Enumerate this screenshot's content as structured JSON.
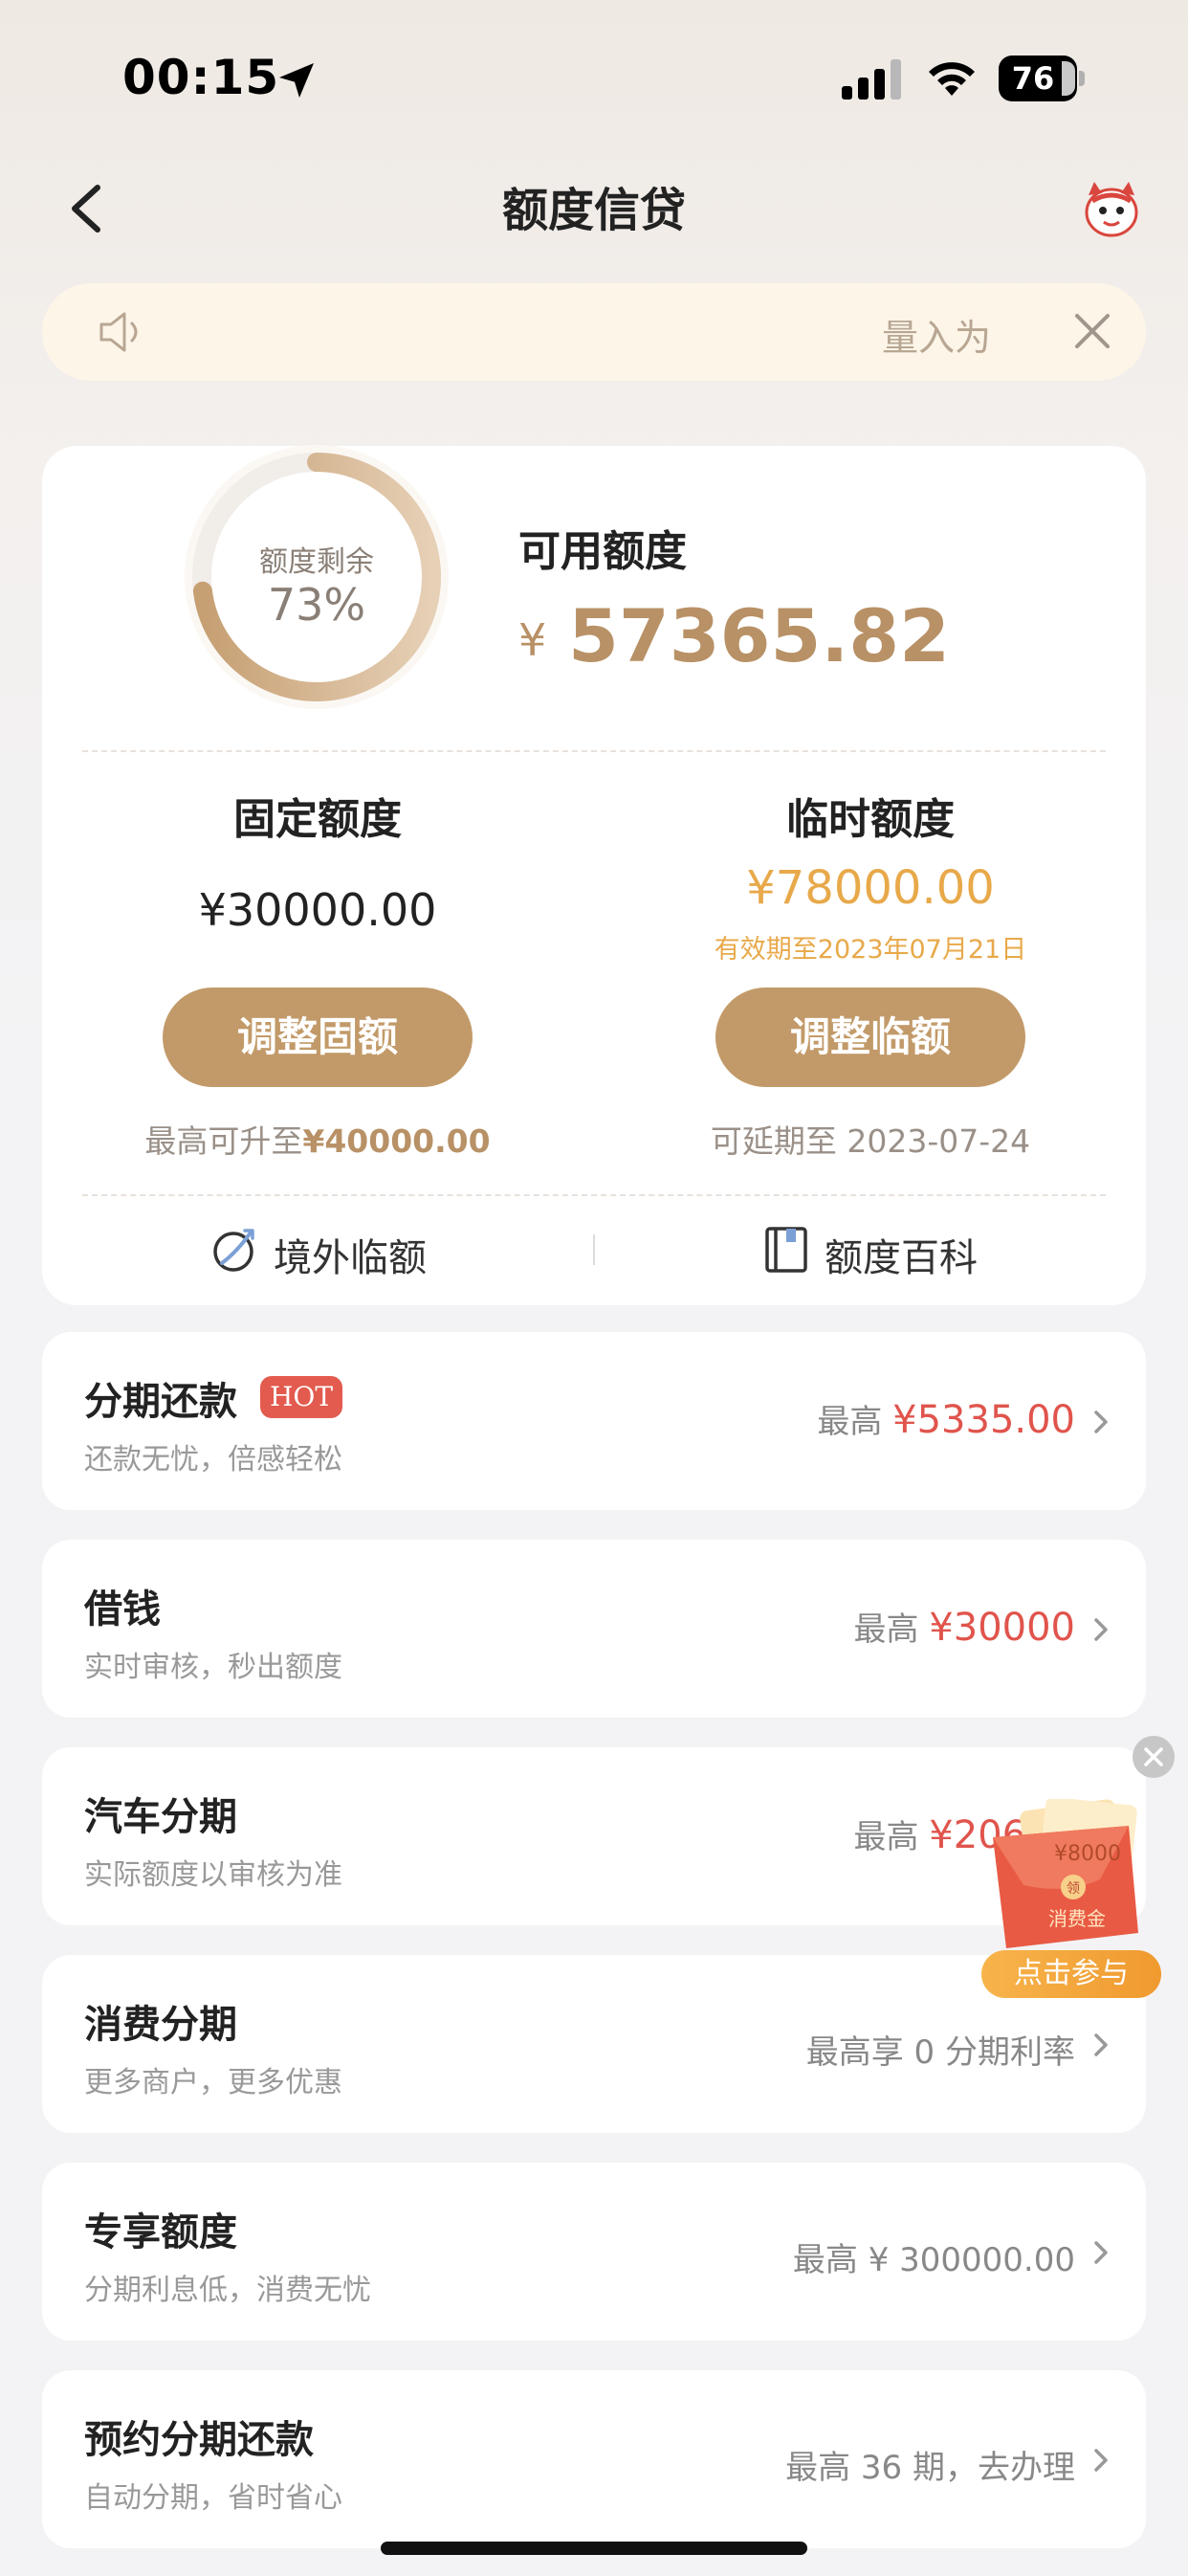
{
  "status_bar": {
    "time": "00:15",
    "battery": "76"
  },
  "nav": {
    "title": "额度信贷"
  },
  "notice": {
    "text": "量入为"
  },
  "summary": {
    "ring_label": "额度剩余",
    "ring_percent": "73%",
    "ring_fraction": 0.73,
    "available_label": "可用额度",
    "currency": "¥",
    "available_amount": "57365.82",
    "fixed": {
      "title": "固定额度",
      "amount": "¥30000.00",
      "button": "调整固额",
      "note_prefix": "最高可升至",
      "note_value": "¥40000.00"
    },
    "temporary": {
      "title": "临时额度",
      "amount": "¥78000.00",
      "valid": "有效期至2023年07月21日",
      "button": "调整临额",
      "note": "可延期至 2023-07-24"
    },
    "links": {
      "overseas": "境外临额",
      "encyclopedia": "额度百科"
    }
  },
  "list": [
    {
      "title": "分期还款",
      "badge": "HOT",
      "subtitle": "还款无忧，倍感轻松",
      "prefix": "最高",
      "amount": "¥5335.00"
    },
    {
      "title": "借钱",
      "subtitle": "实时审核，秒出额度",
      "prefix": "最高",
      "amount": "¥30000"
    },
    {
      "title": "汽车分期",
      "subtitle": "实际额度以审核为准",
      "prefix": "最高",
      "amount": "¥20600"
    },
    {
      "title": "消费分期",
      "subtitle": "更多商户，更多优惠",
      "right_text": "最高享 0 分期利率"
    },
    {
      "title": "专享额度",
      "subtitle": "分期利息低，消费无忧",
      "right_text": "最高 ¥ 300000.00"
    },
    {
      "title": "预约分期还款",
      "subtitle": "自动分期，省时省心",
      "right_text": "最高 36 期，去办理"
    }
  ],
  "promo": {
    "amount": "¥8000",
    "label": "消费金",
    "button": "点击参与"
  },
  "colors": {
    "gold": "#c29a69",
    "accent_red": "#e0544c",
    "orange": "#e8a94a"
  }
}
